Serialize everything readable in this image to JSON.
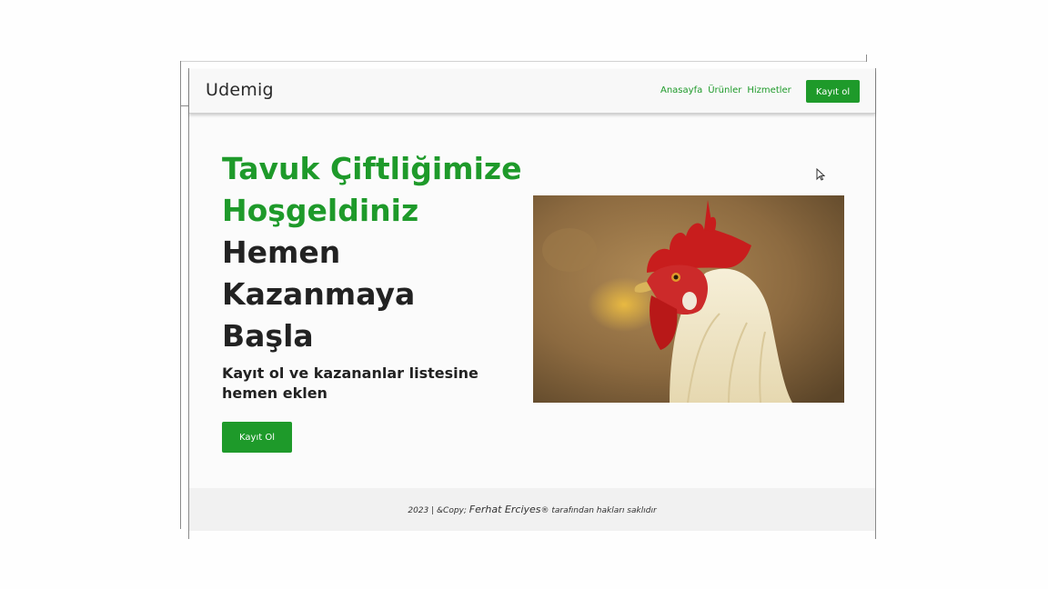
{
  "brand": "Udemig",
  "nav": {
    "links": [
      "Anasayfa",
      "Ürünler",
      "Hizmetler"
    ],
    "cta": "Kayıt ol"
  },
  "hero": {
    "title_green_1": "Tavuk Çiftliğimize",
    "title_green_2": "Hoşgeldiniz",
    "title_dark_1": "Hemen",
    "title_dark_2": "Kazanmaya",
    "title_dark_3": "Başla",
    "subtitle": "Kayıt ol ve kazananlar listesine hemen eklen",
    "button": "Kayıt Ol",
    "image_subject": "rooster-photo"
  },
  "footer": {
    "prefix": "2023 | &Copy;",
    "name": "Ferhat Erciyes",
    "suffix": "® tarafından hakları saklıdır"
  },
  "colors": {
    "accent": "#1e9a2a",
    "text": "#222222",
    "footer_bg": "#f1f1f1"
  }
}
